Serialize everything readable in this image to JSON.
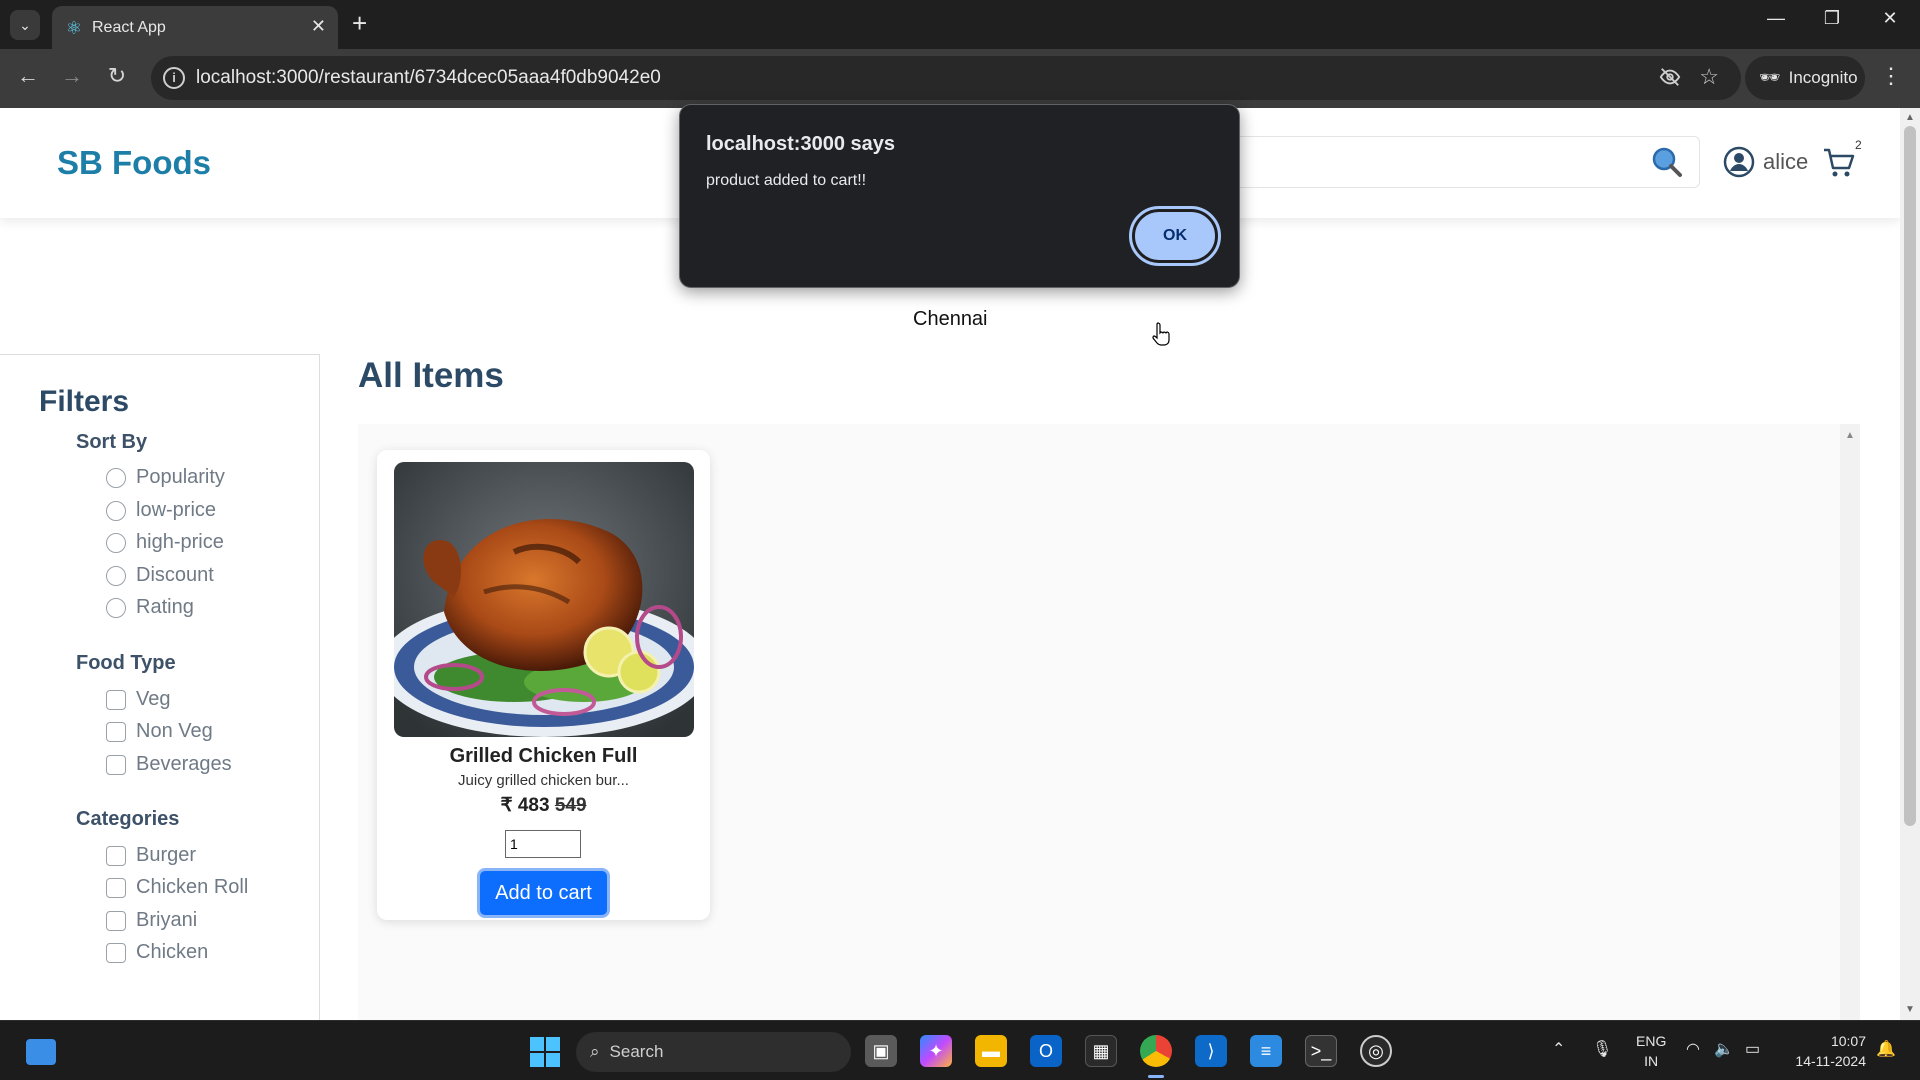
{
  "browser": {
    "tab_title": "React App",
    "url": "localhost:3000/restaurant/6734dcec05aaa4f0db9042e0",
    "profile_label": "Incognito"
  },
  "app": {
    "brand": "SB Foods",
    "username": "alice",
    "cart_count": "2",
    "city": "Chennai"
  },
  "filters": {
    "title": "Filters",
    "sort_by": {
      "title": "Sort By",
      "options": [
        "Popularity",
        "low-price",
        "high-price",
        "Discount",
        "Rating"
      ]
    },
    "food_type": {
      "title": "Food Type",
      "options": [
        "Veg",
        "Non Veg",
        "Beverages"
      ]
    },
    "categories": {
      "title": "Categories",
      "options": [
        "Burger",
        "Chicken Roll",
        "Briyani",
        "Chicken"
      ]
    }
  },
  "items": {
    "title": "All Items",
    "list": [
      {
        "name": "Grilled Chicken Full",
        "description": "Juicy grilled chicken bur...",
        "currency": "₹",
        "price": "483",
        "mrp": "549",
        "quantity": "1",
        "button_label": "Add to cart"
      }
    ]
  },
  "alert": {
    "title": "localhost:3000 says",
    "message": "product added to cart!!",
    "ok_label": "OK"
  },
  "taskbar": {
    "search_label": "Search",
    "lang_top": "ENG",
    "lang_bottom": "IN",
    "time": "10:07",
    "date": "14-11-2024"
  },
  "colors": {
    "brand": "#1d7ea8",
    "heading": "#2c4a66",
    "button": "#0d6efd",
    "dialog_bg": "#202124",
    "dialog_ok": "#a8c7fa"
  }
}
